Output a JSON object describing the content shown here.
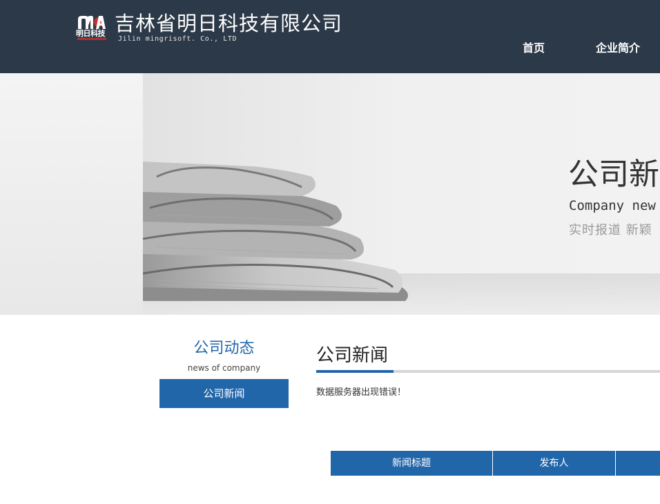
{
  "header": {
    "logo_text": "明日科技",
    "company_name": "吉林省明日科技有限公司",
    "company_en": "Jilin mingrisoft. Co., LTD",
    "nav": [
      "首页",
      "企业简介"
    ]
  },
  "banner": {
    "title": "公司新",
    "subtitle_en": "Company new",
    "slogan": "实时报道 新颖"
  },
  "sidebar": {
    "title": "公司动态",
    "subtitle": "news of company",
    "items": [
      "公司新闻"
    ]
  },
  "main": {
    "title": "公司新闻",
    "message": "数据服务器出现错误！",
    "table_headers": [
      "新闻标题",
      "发布人",
      ""
    ]
  },
  "colors": {
    "header_bg": "#2c3948",
    "accent": "#2266aa",
    "rule": "#d6d6d6"
  }
}
